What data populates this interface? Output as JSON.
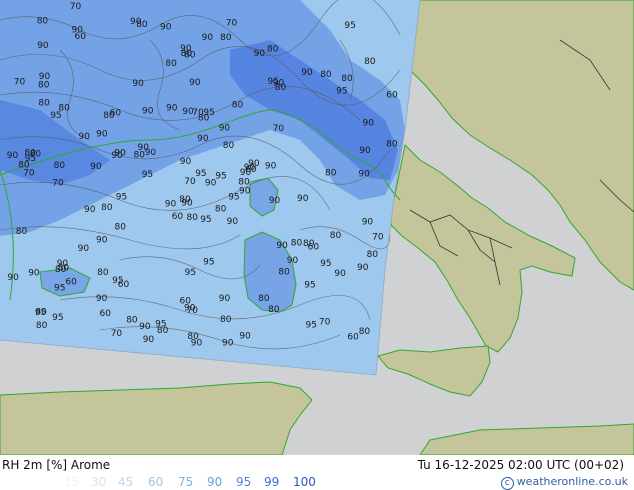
{
  "title": "RH 2m [%] Arome",
  "datetime": "Tu 16-12-2025 02:00 UTC (00+02)",
  "credit": "© weatheronline.co.uk",
  "legend": [
    {
      "label": "15",
      "color": "#eef4fb"
    },
    {
      "label": "30",
      "color": "#d6e6f6"
    },
    {
      "label": "45",
      "color": "#bcd6f2"
    },
    {
      "label": "60",
      "color": "#9cc6ee"
    },
    {
      "label": "75",
      "color": "#7fb4e8"
    },
    {
      "label": "90",
      "color": "#6aa0e2"
    },
    {
      "label": "95",
      "color": "#4f86dc"
    },
    {
      "label": "99",
      "color": "#3a6fd4"
    },
    {
      "label": "100",
      "color": "#2a58c6"
    }
  ],
  "colors": {
    "sea": "#cfd1d3",
    "land": "#c5c59b",
    "coast": "#2fa82f",
    "rh_base": "#9ec8ee",
    "rh_high": "#6f9de4",
    "rh_max": "#3e6ddc",
    "contour": "#555555"
  },
  "contour_labels": [
    "95",
    "95",
    "90",
    "80",
    "90",
    "60",
    "80",
    "95",
    "90",
    "95",
    "60",
    "70",
    "60",
    "60",
    "70",
    "90",
    "80",
    "60",
    "90",
    "80",
    "60",
    "70",
    "60",
    "60",
    "80",
    "80",
    "70",
    "90",
    "80",
    "80",
    "60",
    "70",
    "60",
    "90",
    "95",
    "60",
    "80",
    "70",
    "80",
    "90",
    "80",
    "70",
    "90",
    "80",
    "70",
    "90",
    "95",
    "90",
    "70",
    "90",
    "80",
    "90",
    "90",
    "80",
    "90",
    "80",
    "90",
    "95",
    "80",
    "90",
    "80",
    "70",
    "90",
    "80",
    "95",
    "90",
    "95",
    "90",
    "80",
    "90",
    "95",
    "90",
    "90",
    "80",
    "90",
    "80",
    "95",
    "95",
    "90",
    "80",
    "80",
    "90",
    "95",
    "70",
    "90",
    "80",
    "90",
    "90",
    "95",
    "90",
    "90",
    "95",
    "90",
    "95",
    "80",
    "90",
    "90",
    "80",
    "90",
    "80",
    "80",
    "90",
    "95",
    "95",
    "90",
    "80",
    "80",
    "90",
    "80",
    "90",
    "80",
    "80",
    "90",
    "90",
    "80",
    "95",
    "90",
    "90",
    "90",
    "90",
    "80",
    "80",
    "80",
    "80",
    "80",
    "90",
    "90",
    "90",
    "70",
    "95",
    "80",
    "90",
    "90",
    "90",
    "80",
    "90",
    "80",
    "90",
    "90",
    "95",
    "95",
    "90",
    "80",
    "90",
    "80",
    "80",
    "90",
    "80",
    "80",
    "90",
    "90",
    "80",
    "80"
  ]
}
